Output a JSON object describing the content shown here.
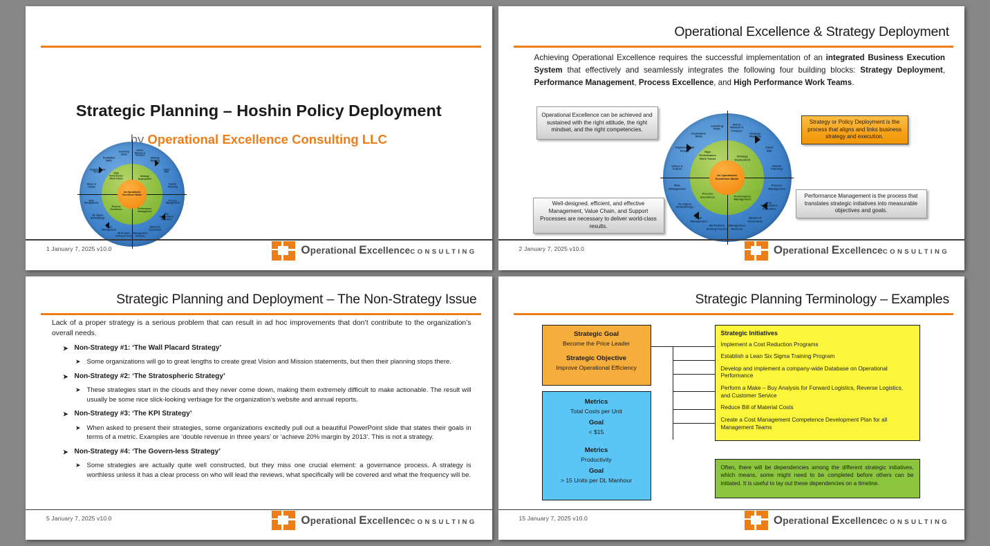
{
  "brand": {
    "accent": "#ED7D17",
    "logo_line1_a": "perational ",
    "logo_line1_b": "xcellence",
    "logo_cap1": "O",
    "logo_cap2": "E",
    "logo_line2": "CONSULTING"
  },
  "wheel": {
    "core": "An\nOperational\nExcellence\nModel",
    "quadrants": [
      {
        "label": "Strategy\nDeployment"
      },
      {
        "label": "Performance\nManagement"
      },
      {
        "label": "Process\nExcellence"
      },
      {
        "label": "High\nPerformance\nWork Teams"
      }
    ],
    "outer": [
      "Vision,\nMission &\nPurpose",
      "Strategy\nMapping",
      "Catch\nBall",
      "Hoshin\nPlanning",
      "Process\nManagement",
      "Key\nPerformance\nIndicators",
      "Balanced\nScorecards",
      "Management\nReviews",
      "8D Problem\nSolving Process",
      "Lean\nManagement",
      "Six Sigma\nMethodology",
      "Risk\nManagement",
      "Values &\nCulture",
      "Organizational\nDesign",
      "Facilitation\nSkills",
      "Coaching\nSkills"
    ]
  },
  "slide1": {
    "title": "Strategic Planning – Hoshin Policy Deployment",
    "by_prefix": "by ",
    "by_company": "Operational Excellence Consulting LLC",
    "footer": "1  January 7, 2025 v10.0"
  },
  "slide2": {
    "title": "Operational Excellence & Strategy Deployment",
    "body": [
      {
        "t": "Achieving Operational Excellence requires the successful implementation of an ",
        "b": false
      },
      {
        "t": "integrated Business Execution System",
        "b": true
      },
      {
        "t": " that effectively and seamlessly integrates the following four building blocks: ",
        "b": false
      },
      {
        "t": "Strategy Deployment",
        "b": true
      },
      {
        "t": ", ",
        "b": false
      },
      {
        "t": "Performance Management",
        "b": true
      },
      {
        "t": ", ",
        "b": false
      },
      {
        "t": "Process Excellence",
        "b": true
      },
      {
        "t": ", and ",
        "b": false
      },
      {
        "t": "High Performance Work Teams",
        "b": true
      },
      {
        "t": ".",
        "b": false
      }
    ],
    "callout_top_left": "Operational Excellence can be achieved and sustained with the right attitude, the right mindset, and the right competencies.",
    "callout_top_right": "Strategy or Policy Deployment is the process that aligns and links business strategy and execution.",
    "callout_bottom_left": "Well-designed, efficient, and effective Management, Value Chain, and Support Processes are necessary to deliver world-class results.",
    "callout_bottom_right": "Performance Management is the process that translates strategic initiatives into measurable objectives and goals.",
    "footer": "2  January 7, 2025 v10.0"
  },
  "slide3": {
    "title": "Strategic Planning and Deployment – The Non-Strategy Issue",
    "lead": "Lack of a proper strategy is a serious problem that can result in ad hoc improvements that don’t contribute to the organization’s overall needs.",
    "items": [
      {
        "head": "Non-Strategy #1: ‘The Wall Placard Strategy’",
        "sub": "Some organizations will go to great lengths to create great Vision and Mission statements, but then their planning stops there."
      },
      {
        "head": "Non-Strategy #2: ‘The Stratospheric Strategy’",
        "sub": "These strategies start in the clouds and they never come down, making them extremely difficult to make actionable. The result will usually be some nice slick-looking verbiage for the organization’s website and annual reports."
      },
      {
        "head": "Non-Strategy #3: ‘The KPI Strategy’",
        "sub": "When asked to present their strategies, some organizations excitedly pull out a beautiful PowerPoint slide that states their goals in terms of a metric. Examples are ‘double revenue in three years’ or ‘achieve 20% margin by 2013’. This is not a strategy."
      },
      {
        "head": "Non-Strategy #4: ‘The Govern-less Strategy’",
        "sub": "Some strategies are actually quite well constructed, but they miss one crucial element: a governance process. A strategy is worthless unless it has a clear process on who will lead the reviews, what specifically will be covered and what the frequency will be."
      }
    ],
    "bullet_glyph": "➤",
    "footer": "5  January 7, 2025 v10.0"
  },
  "slide4": {
    "title": "Strategic Planning Terminology – Examples",
    "goal_box": [
      {
        "label": "Strategic Goal",
        "value": "Become the Price Leader"
      },
      {
        "label": "Strategic Objective",
        "value": "Improve Operational Efficiency"
      }
    ],
    "metrics_box": [
      {
        "label": "Metrics",
        "value": "Total Costs per Unit"
      },
      {
        "label": "Goal",
        "value": "< $15"
      },
      {
        "label": "Metrics",
        "value": "Productivity"
      },
      {
        "label": "Goal",
        "value": "> 15 Units per DL Manhour"
      }
    ],
    "initiatives_header": "Strategic Initiatives",
    "initiatives": [
      "Implement a Cost Reduction Programs",
      "Establish a Lean Six Sigma Training Program",
      "Develop and implement a company-wide Database on Operational Performance",
      "Perform a Make – Buy Analysis for Forward Logistics, Reverse Logistics, and Customer Service",
      "Reduce Bill of Material Costs",
      "Create a Cost Management Competence Development Plan for all Management Teams"
    ],
    "note": "Often, there will be dependencies among the different strategic initiatives, which means, some might need to be completed before others can be initiated. It is useful to lay out these dependencies on a timeline.",
    "footer": "15  January 7, 2025 v10.0"
  }
}
